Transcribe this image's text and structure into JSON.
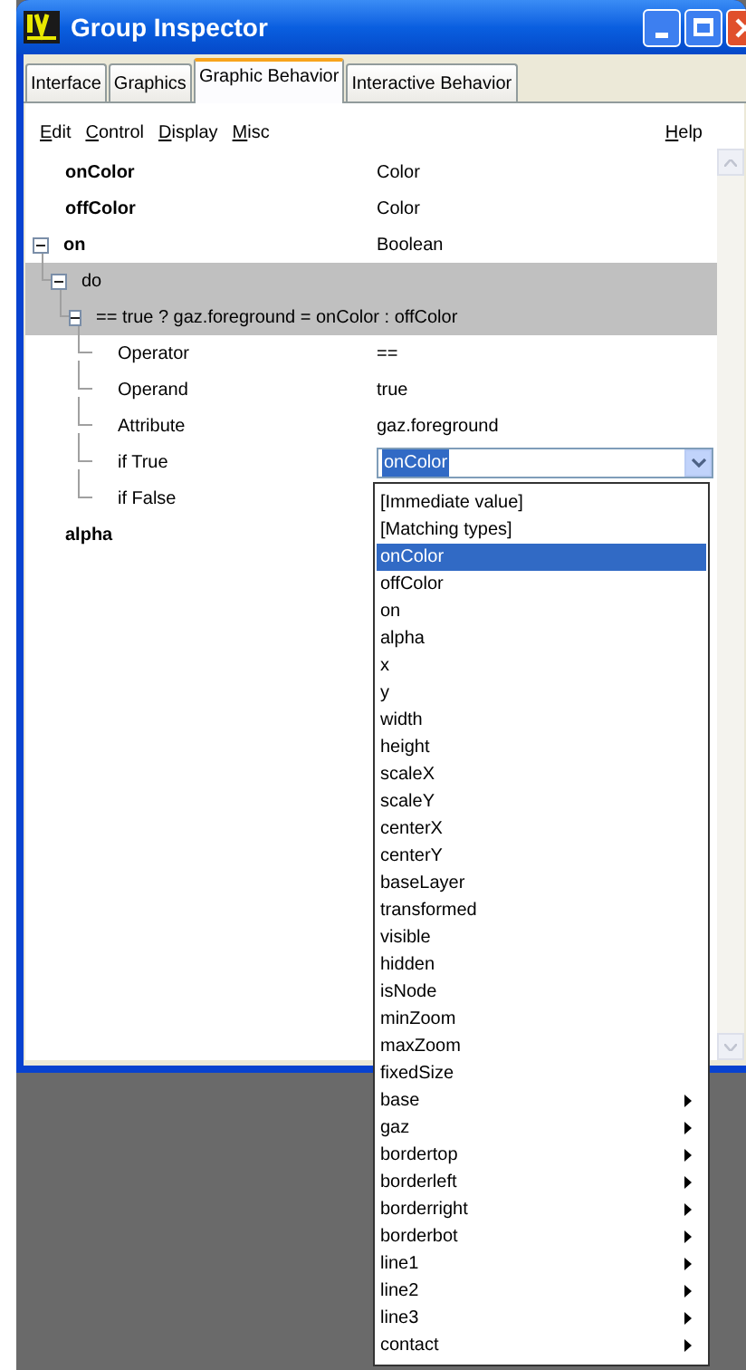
{
  "window": {
    "title": "Group Inspector"
  },
  "tabs": [
    {
      "label": "Interface",
      "selected": false
    },
    {
      "label": "Graphics",
      "selected": false
    },
    {
      "label": "Graphic Behavior",
      "selected": true
    },
    {
      "label": "Interactive Behavior",
      "selected": false
    }
  ],
  "menu": {
    "items": [
      "Edit",
      "Control",
      "Display",
      "Misc"
    ],
    "help": "Help"
  },
  "tree": [
    {
      "name": "onColor",
      "value": "Color",
      "selected": false
    },
    {
      "name": "offColor",
      "value": "Color",
      "selected": false
    },
    {
      "name": "on",
      "value": "Boolean",
      "selected": false,
      "expanded": true,
      "children": [
        {
          "name": "do",
          "selected": true,
          "expanded": true,
          "children": [
            {
              "name": "== true ? gaz.foreground = onColor : offColor",
              "selected": true,
              "expanded": true,
              "children": [
                {
                  "name": "Operator",
                  "value": "==",
                  "selected": false
                },
                {
                  "name": "Operand",
                  "value": "true",
                  "selected": false
                },
                {
                  "name": "Attribute",
                  "value": "gaz.foreground",
                  "selected": false
                },
                {
                  "name": "if True",
                  "combo": "onColor",
                  "selected": false
                },
                {
                  "name": "if False",
                  "selected": false
                }
              ]
            }
          ]
        }
      ]
    },
    {
      "name": "alpha",
      "selected": false
    }
  ],
  "dropdown": [
    {
      "label": "[Immediate value]",
      "selected": false,
      "submenu": false
    },
    {
      "label": "[Matching types]",
      "selected": false,
      "submenu": false
    },
    {
      "label": "onColor",
      "selected": true,
      "submenu": false
    },
    {
      "label": "offColor",
      "selected": false,
      "submenu": false
    },
    {
      "label": "on",
      "selected": false,
      "submenu": false
    },
    {
      "label": "alpha",
      "selected": false,
      "submenu": false
    },
    {
      "label": "x",
      "selected": false,
      "submenu": false
    },
    {
      "label": "y",
      "selected": false,
      "submenu": false
    },
    {
      "label": "width",
      "selected": false,
      "submenu": false
    },
    {
      "label": "height",
      "selected": false,
      "submenu": false
    },
    {
      "label": "scaleX",
      "selected": false,
      "submenu": false
    },
    {
      "label": "scaleY",
      "selected": false,
      "submenu": false
    },
    {
      "label": "centerX",
      "selected": false,
      "submenu": false
    },
    {
      "label": "centerY",
      "selected": false,
      "submenu": false
    },
    {
      "label": "baseLayer",
      "selected": false,
      "submenu": false
    },
    {
      "label": "transformed",
      "selected": false,
      "submenu": false
    },
    {
      "label": "visible",
      "selected": false,
      "submenu": false
    },
    {
      "label": "hidden",
      "selected": false,
      "submenu": false
    },
    {
      "label": "isNode",
      "selected": false,
      "submenu": false
    },
    {
      "label": "minZoom",
      "selected": false,
      "submenu": false
    },
    {
      "label": "maxZoom",
      "selected": false,
      "submenu": false
    },
    {
      "label": "fixedSize",
      "selected": false,
      "submenu": false
    },
    {
      "label": "base",
      "selected": false,
      "submenu": true
    },
    {
      "label": "gaz",
      "selected": false,
      "submenu": true
    },
    {
      "label": "bordertop",
      "selected": false,
      "submenu": true
    },
    {
      "label": "borderleft",
      "selected": false,
      "submenu": true
    },
    {
      "label": "borderright",
      "selected": false,
      "submenu": true
    },
    {
      "label": "borderbot",
      "selected": false,
      "submenu": true
    },
    {
      "label": "line1",
      "selected": false,
      "submenu": true
    },
    {
      "label": "line2",
      "selected": false,
      "submenu": true
    },
    {
      "label": "line3",
      "selected": false,
      "submenu": true
    },
    {
      "label": "contact",
      "selected": false,
      "submenu": true
    }
  ]
}
